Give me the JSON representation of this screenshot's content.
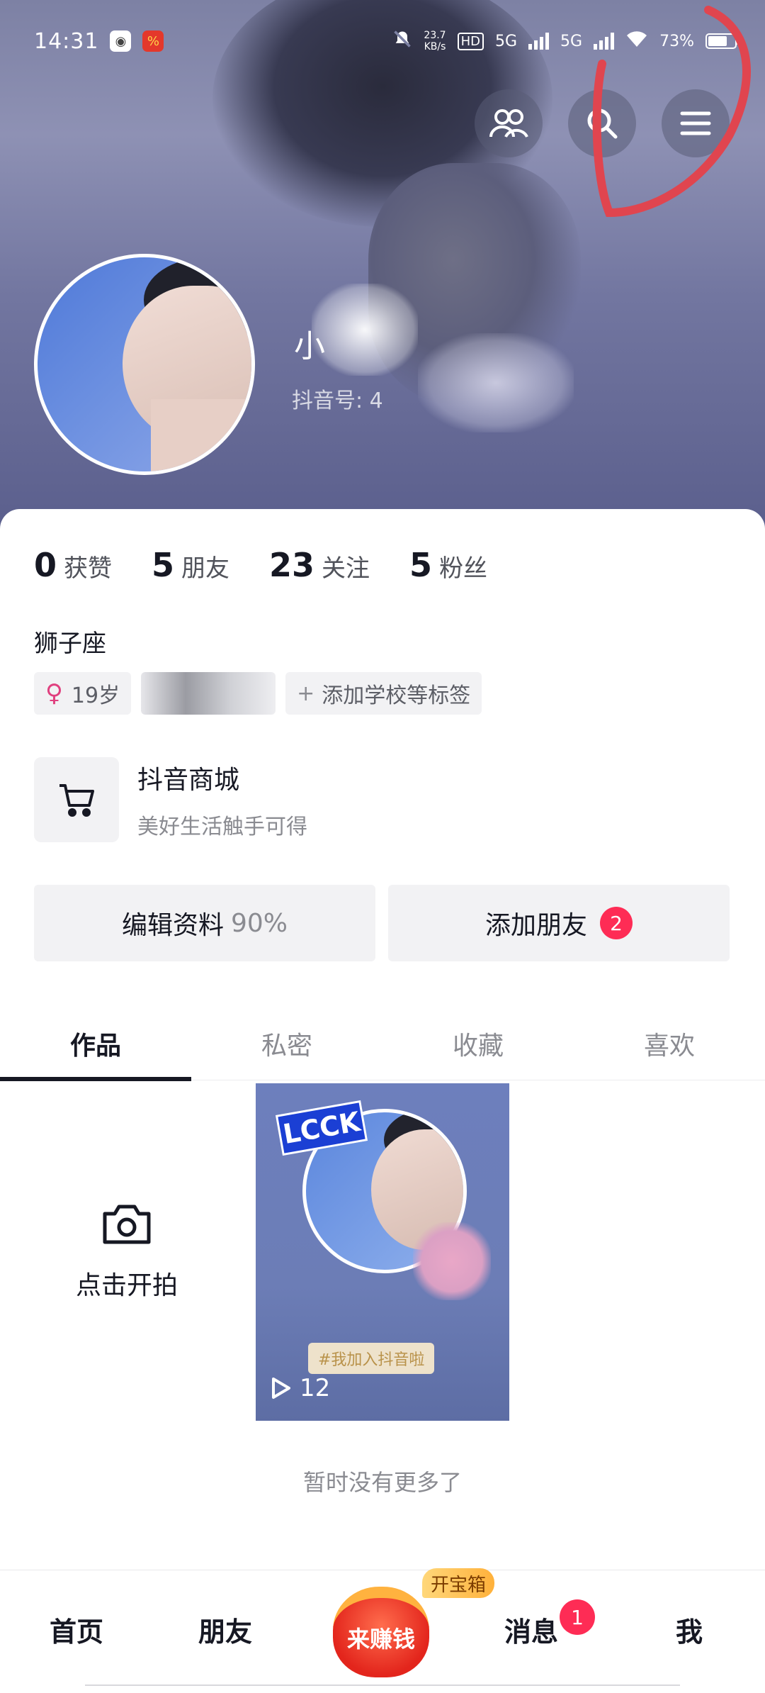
{
  "status_bar": {
    "time": "14:31",
    "network_speed": "23.7",
    "network_speed_unit": "KB/s",
    "hd_label": "HD",
    "signal_1": "5G",
    "signal_2": "5G",
    "battery": "73%",
    "battery_level": 0.73
  },
  "profile": {
    "nickname_visible": "小",
    "douyin_id_label": "抖音号: 4"
  },
  "stats": [
    {
      "value": "0",
      "label": "获赞"
    },
    {
      "value": "5",
      "label": "朋友"
    },
    {
      "value": "23",
      "label": "关注"
    },
    {
      "value": "5",
      "label": "粉丝"
    }
  ],
  "bio": {
    "zodiac": "狮子座",
    "gender_symbol": "♀",
    "age": "19岁",
    "add_tag": "添加学校等标签"
  },
  "shop": {
    "title": "抖音商城",
    "subtitle": "美好生活触手可得"
  },
  "actions": {
    "edit_profile": "编辑资料",
    "edit_progress": "90%",
    "add_friend": "添加朋友",
    "add_friend_badge": "2"
  },
  "tabs": [
    "作品",
    "私密",
    "收藏",
    "喜欢"
  ],
  "works": {
    "shoot_label": "点击开拍",
    "video": {
      "sticker_text": "LCCK",
      "hashtag": "#我加入抖音啦",
      "plays": "12"
    },
    "no_more": "暂时没有更多了"
  },
  "bottom_nav": {
    "home": "首页",
    "friends": "朋友",
    "earn": "来赚钱",
    "chest": "开宝箱",
    "messages": "消息",
    "messages_badge": "1",
    "me": "我"
  },
  "colors": {
    "accent_red": "#fe2c55",
    "annotation_red": "#e0454f",
    "cover_purple": "#7276a0"
  }
}
